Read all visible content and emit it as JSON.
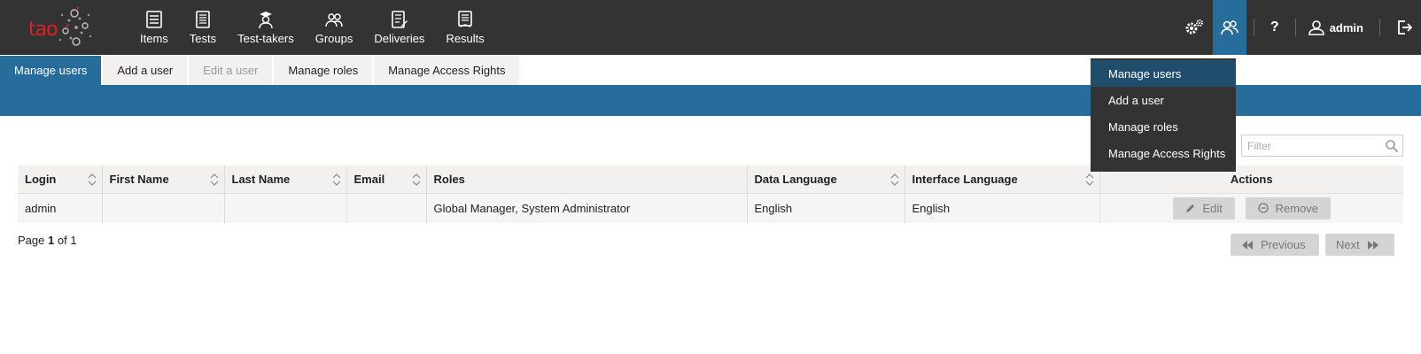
{
  "logo": {
    "text": "tao"
  },
  "main_nav": [
    {
      "label": "Items",
      "icon": "items-icon"
    },
    {
      "label": "Tests",
      "icon": "tests-icon"
    },
    {
      "label": "Test-takers",
      "icon": "test-takers-icon"
    },
    {
      "label": "Groups",
      "icon": "groups-icon"
    },
    {
      "label": "Deliveries",
      "icon": "deliveries-icon"
    },
    {
      "label": "Results",
      "icon": "results-icon"
    }
  ],
  "user_menu": {
    "help": "?",
    "username": "admin"
  },
  "tabs": [
    {
      "label": "Manage users",
      "state": "active"
    },
    {
      "label": "Add a user",
      "state": "normal"
    },
    {
      "label": "Edit a user",
      "state": "disabled"
    },
    {
      "label": "Manage roles",
      "state": "normal"
    },
    {
      "label": "Manage Access Rights",
      "state": "normal"
    }
  ],
  "dropdown": {
    "items": [
      {
        "label": "Manage users",
        "active": true
      },
      {
        "label": "Add a user",
        "active": false
      },
      {
        "label": "Manage roles",
        "active": false
      },
      {
        "label": "Manage Access Rights",
        "active": false
      }
    ]
  },
  "filter": {
    "placeholder": "Filter",
    "value": ""
  },
  "table": {
    "columns": [
      "Login",
      "First Name",
      "Last Name",
      "Email",
      "Roles",
      "Data Language",
      "Interface Language",
      "Actions"
    ],
    "rows": [
      {
        "login": "admin",
        "first_name": "",
        "last_name": "",
        "email": "",
        "roles": "Global Manager, System Administrator",
        "data_language": "English",
        "interface_language": "English"
      }
    ],
    "actions": {
      "edit": "Edit",
      "remove": "Remove"
    }
  },
  "pager": {
    "prefix": "Page",
    "page": "1",
    "of": "of",
    "total": "1",
    "previous": "Previous",
    "next": "Next"
  },
  "colors": {
    "topbar": "#333333",
    "accent": "#266d9c",
    "tab_bg": "#f3f1ef"
  }
}
